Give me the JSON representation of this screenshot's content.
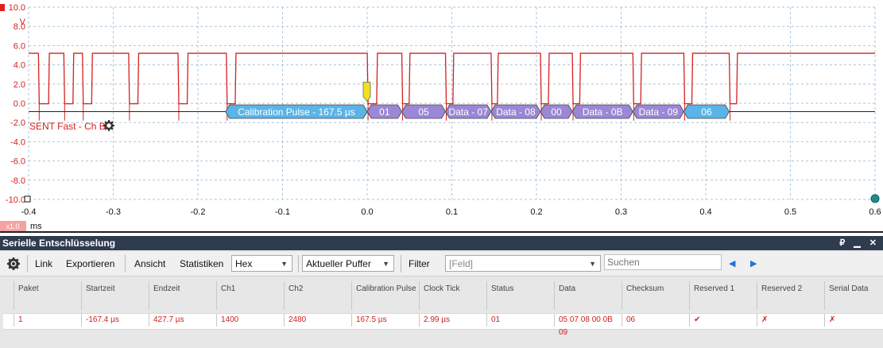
{
  "scope": {
    "y_unit": "V",
    "y_ticks": [
      "10.0",
      "8.0",
      "6.0",
      "4.0",
      "2.0",
      "0.0",
      "-2.0",
      "-4.0",
      "-6.0",
      "-8.0",
      "-10.0"
    ],
    "x_ticks": [
      "-0.4",
      "-0.3",
      "-0.2",
      "-0.1",
      "0.0",
      "0.1",
      "0.2",
      "0.3",
      "0.4",
      "0.5",
      "0.6"
    ],
    "x_unit": "ms",
    "zoom_badge": "x1.0",
    "decoder_label": "SENT Fast - Ch B",
    "channel_color": "#d62020",
    "packets": [
      {
        "label": "Calibration Pulse - 167.5 µs",
        "color": "#5ab4e8",
        "start": -0.1674,
        "end": 0.0001
      },
      {
        "label": "01",
        "color": "#9b87d6",
        "start": 0.0001,
        "end": 0.0409
      },
      {
        "label": "05",
        "color": "#9b87d6",
        "start": 0.0409,
        "end": 0.0925
      },
      {
        "label": "Data - 07",
        "color": "#9b87d6",
        "start": 0.0925,
        "end": 0.1464
      },
      {
        "label": "Data - 08",
        "color": "#9b87d6",
        "start": 0.1464,
        "end": 0.2047
      },
      {
        "label": "00",
        "color": "#9b87d6",
        "start": 0.2047,
        "end": 0.2423
      },
      {
        "label": "Data - 0B",
        "color": "#9b87d6",
        "start": 0.2423,
        "end": 0.3139
      },
      {
        "label": "Data - 09",
        "color": "#9b87d6",
        "start": 0.3139,
        "end": 0.3741
      },
      {
        "label": "06",
        "color": "#5ab4e8",
        "start": 0.3741,
        "end": 0.4277
      }
    ],
    "low_intervals": [
      [
        -0.3884,
        -0.3755
      ],
      [
        -0.3584,
        -0.3467
      ],
      [
        -0.3364,
        -0.3246
      ],
      [
        -0.2818,
        -0.27
      ],
      [
        -0.2235,
        -0.2117
      ],
      [
        -0.1664,
        -0.155
      ],
      [
        0.0001,
        0.0121
      ],
      [
        0.0409,
        0.0505
      ],
      [
        0.0925,
        0.1022
      ],
      [
        0.1464,
        0.1548
      ],
      [
        0.2047,
        0.215
      ],
      [
        0.2423,
        0.252
      ],
      [
        0.3139,
        0.3241
      ],
      [
        0.3741,
        0.3845
      ],
      [
        0.4277,
        0.4374
      ]
    ]
  },
  "decoder": {
    "title": "Serielle Entschlüsselung",
    "window_controls": "₽ ▁ ✕",
    "toolbar": {
      "link": "Link",
      "export": "Exportieren",
      "view": "Ansicht",
      "stats": "Statistiken",
      "format": "Hex",
      "buffer": "Aktueller Puffer",
      "filter": "Filter",
      "field": "[Feld]",
      "search_placeholder": "Suchen"
    },
    "columns": [
      "Paket",
      "Startzeit",
      "Endzeit",
      "Ch1",
      "Ch2",
      "Calibration Pulse",
      "Clock Tick",
      "Status",
      "Data",
      "Checksum",
      "Reserved 1",
      "Reserved 2",
      "Serial Data"
    ],
    "rows": [
      [
        "1",
        "-167.4 µs",
        "427.7 µs",
        "1400",
        "2480",
        "167.5 µs",
        "2.99 µs",
        "01",
        "05 07 08 00 0B 09",
        "06",
        "✔",
        "✗",
        "✗"
      ]
    ]
  }
}
